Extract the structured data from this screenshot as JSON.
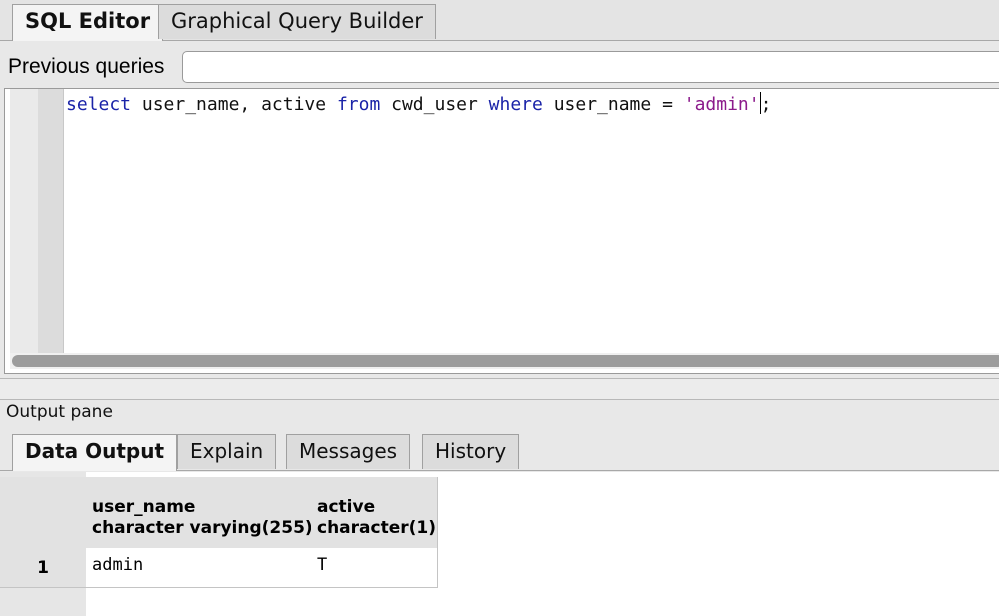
{
  "editor_tabs": [
    {
      "label": "SQL Editor",
      "active": true
    },
    {
      "label": "Graphical Query Builder",
      "active": false
    }
  ],
  "previous_queries": {
    "label": "Previous queries",
    "value": ""
  },
  "editor": {
    "tokens": [
      {
        "text": "select",
        "kind": "keyword"
      },
      {
        "text": " user_name, active ",
        "kind": "plain"
      },
      {
        "text": "from",
        "kind": "keyword"
      },
      {
        "text": " cwd_user ",
        "kind": "plain"
      },
      {
        "text": "where",
        "kind": "keyword"
      },
      {
        "text": " user_name = ",
        "kind": "plain"
      },
      {
        "text": "'admin'",
        "kind": "string"
      },
      {
        "text": ";",
        "kind": "plain"
      }
    ]
  },
  "output": {
    "title": "Output pane",
    "tabs": [
      {
        "label": "Data Output",
        "active": true
      },
      {
        "label": "Explain",
        "active": false
      },
      {
        "label": "Messages",
        "active": false
      },
      {
        "label": "History",
        "active": false
      }
    ],
    "columns": [
      {
        "name": "user_name",
        "type": "character varying(255)"
      },
      {
        "name": "active",
        "type": "character(1)"
      }
    ],
    "rows": [
      {
        "num": "1",
        "cells": [
          "admin",
          "T"
        ]
      }
    ]
  },
  "colors": {
    "keyword": "#1a23a8",
    "string": "#8b1a8b"
  }
}
